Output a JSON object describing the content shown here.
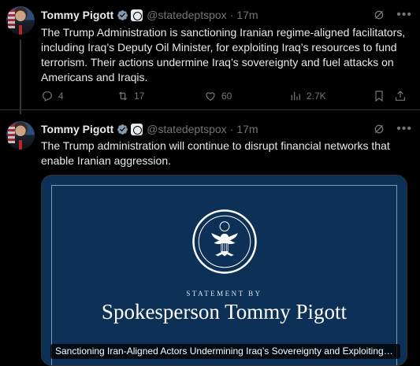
{
  "tweets": [
    {
      "author": {
        "name": "Tommy Pigott",
        "handle": "@statedeptspox",
        "time": "17m"
      },
      "separator": "·",
      "text": "The Trump Administration is sanctioning Iranian regime-aligned facilitators, including Iraq’s Deputy Oil Minister, for exploiting Iraq’s resources to fund terrorism. Their actions undermine Iraq’s sovereignty and fuel attacks on Americans and Iraqis.",
      "stats": {
        "replies": "4",
        "retweets": "17",
        "likes": "60",
        "views": "2.7K"
      }
    },
    {
      "author": {
        "name": "Tommy Pigott",
        "handle": "@statedeptspox",
        "time": "17m"
      },
      "separator": "·",
      "text": "The Trump administration will continue to disrupt financial networks that enable Iranian aggression.",
      "card": {
        "statement_label": "STATEMENT BY",
        "statement_title": "Spokesperson Tommy Pigott",
        "caption": "Sanctioning Iran-Aligned Actors Undermining Iraq’s Sovereignty and Exploiting It..."
      }
    }
  ],
  "colors": {
    "background": "#000000",
    "text": "#e7e9ea",
    "muted": "#71767b",
    "verified": "#829aab",
    "card_bg": "#0d3156"
  },
  "icons": [
    "verified-badge-icon",
    "affiliation-badge-icon",
    "grok-icon",
    "more-icon",
    "reply-icon",
    "retweet-icon",
    "like-icon",
    "views-icon",
    "bookmark-icon",
    "share-icon",
    "state-department-seal-icon"
  ]
}
